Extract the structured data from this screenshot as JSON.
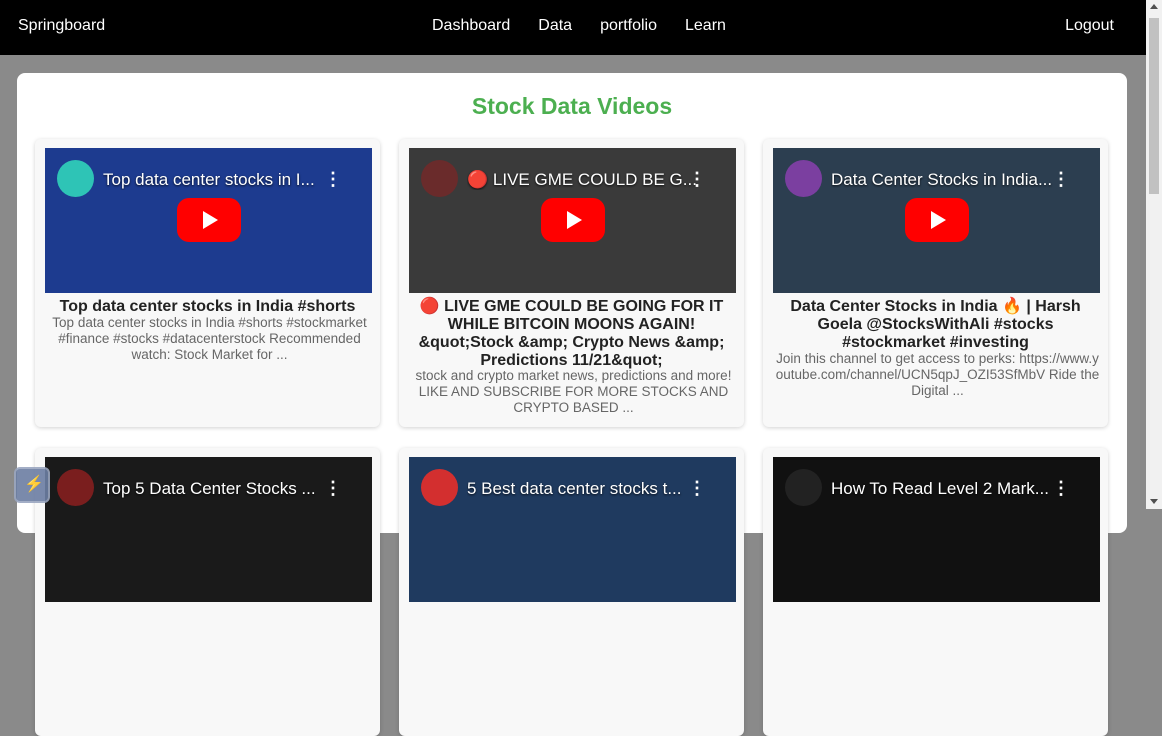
{
  "nav": {
    "brand": "Springboard",
    "links": [
      "Dashboard",
      "Data",
      "portfolio",
      "Learn"
    ],
    "logout": "Logout"
  },
  "page": {
    "title": "Stock Data Videos"
  },
  "videos": [
    {
      "thumb_title": "Top data center stocks in I...",
      "title": "Top data center stocks in India #shorts",
      "description": "Top data center stocks in India #shorts #stockmarket #finance #stocks #datacenterstock Recommended watch: Stock Market for ..."
    },
    {
      "thumb_title": "🔴 LIVE GME COULD BE G...",
      "title": "🔴 LIVE GME COULD BE GOING FOR IT WHILE BITCOIN MOONS AGAIN! &quot;Stock &amp; Crypto News &amp; Predictions 11/21&quot;",
      "description": "stock and crypto market news, predictions and more! LIKE AND SUBSCRIBE FOR MORE STOCKS AND CRYPTO BASED ..."
    },
    {
      "thumb_title": "Data Center Stocks in India...",
      "title": "Data Center Stocks in India 🔥 | Harsh Goela @StocksWithAli #stocks #stockmarket #investing",
      "description": "Join this channel to get access to perks: https://www.youtube.com/channel/UCN5qpJ_OZI53SfMbV Ride the Digital ..."
    },
    {
      "thumb_title": "Top 5 Data Center Stocks ..."
    },
    {
      "thumb_title": "5 Best data center stocks t..."
    },
    {
      "thumb_title": "How To Read Level 2 Mark..."
    }
  ]
}
